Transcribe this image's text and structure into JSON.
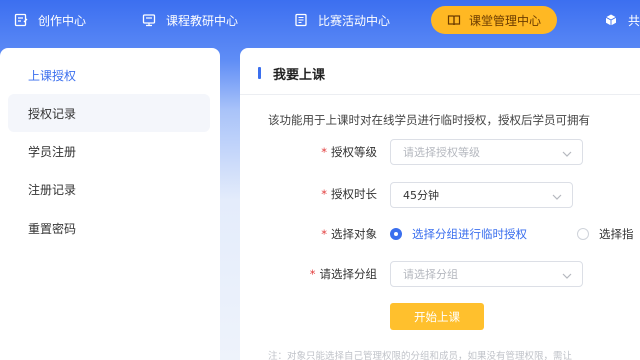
{
  "topnav": {
    "items": [
      {
        "label": "创作中心",
        "icon": "edit-doc-icon"
      },
      {
        "label": "课程教研中心",
        "icon": "monitor-icon"
      },
      {
        "label": "比赛活动中心",
        "icon": "list-doc-icon"
      },
      {
        "label": "课堂管理中心",
        "icon": "book-icon",
        "active": true
      },
      {
        "label": "共",
        "icon": "cube-icon"
      }
    ]
  },
  "sidebar": {
    "items": [
      {
        "label": "上课授权",
        "active": true
      },
      {
        "label": "授权记录"
      },
      {
        "label": "学员注册"
      },
      {
        "label": "注册记录"
      },
      {
        "label": "重置密码"
      }
    ]
  },
  "main": {
    "title": "我要上课",
    "description": "该功能用于上课时对在线学员进行临时授权，授权后学员可拥有",
    "form": {
      "level_label": "授权等级",
      "level_placeholder": "请选择授权等级",
      "duration_label": "授权时长",
      "duration_value": "45分钟",
      "target_label": "选择对象",
      "target_option_group": "选择分组进行临时授权",
      "target_option_other": "选择指",
      "group_label": "请选择分组",
      "group_placeholder": "请选择分组",
      "required_mark": "*"
    },
    "start_button": "开始上课",
    "note": "注：对象只能选择自己管理权限的分组和成员，如果没有管理权限，需让"
  },
  "colors": {
    "accent": "#3b6fee",
    "active_nav": "#ffb823",
    "button": "#ffc02d",
    "required": "#e23b3b"
  }
}
